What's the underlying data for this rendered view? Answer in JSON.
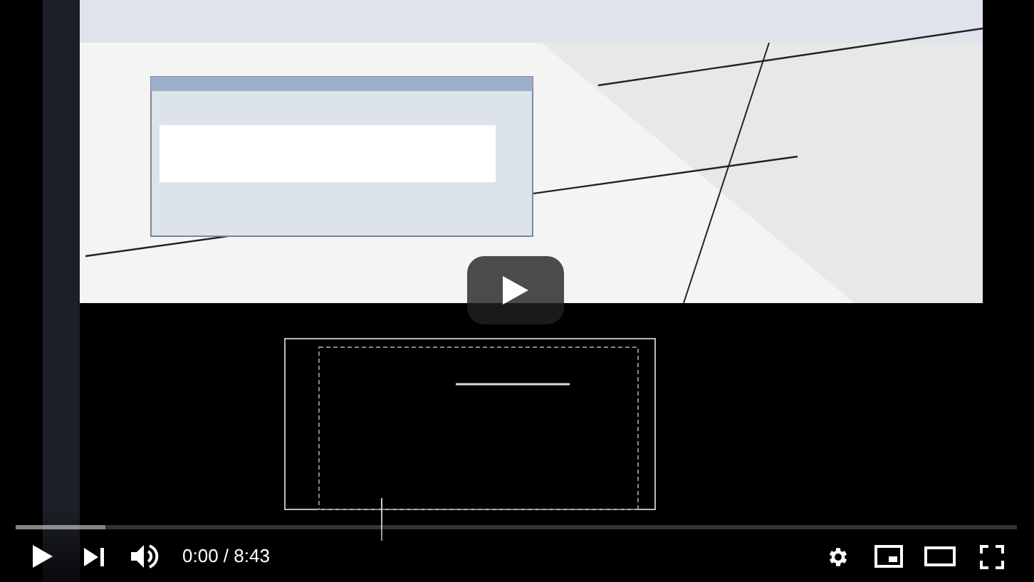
{
  "player": {
    "progress": {
      "level": 0
    },
    "buffer": {
      "level": 0.09
    },
    "time": "0:00 / 8:43"
  }
}
